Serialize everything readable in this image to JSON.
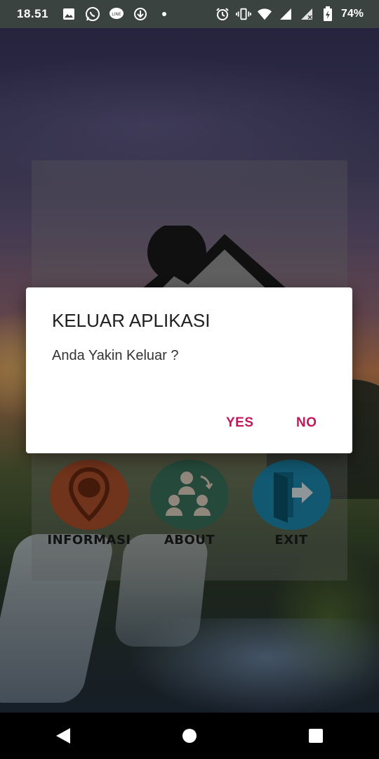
{
  "status_bar": {
    "time": "18.51",
    "battery_percent": "74%",
    "notification_icons": [
      "image-icon",
      "whatsapp-icon",
      "line-icon",
      "download-icon",
      "dot-icon"
    ],
    "system_icons": [
      "alarm-icon",
      "vibrate-icon",
      "wifi-icon",
      "signal-icon",
      "signal-noservice-icon",
      "battery-charging-icon"
    ]
  },
  "menu": {
    "items": [
      {
        "label": "INFORMASI",
        "color": "#b5532c",
        "icon": "location-pin-icon"
      },
      {
        "label": "ABOUT",
        "color": "#3d7862",
        "icon": "group-icon"
      },
      {
        "label": "EXIT",
        "color": "#1d8fb5",
        "icon": "exit-door-icon"
      }
    ]
  },
  "dialog": {
    "title": "KELUAR APLIKASI",
    "message": "Anda Yakin Keluar ?",
    "positive_label": "YES",
    "negative_label": "NO",
    "accent_color": "#c2185b"
  },
  "nav_bar": {
    "buttons": [
      "back-icon",
      "home-icon",
      "recents-icon"
    ]
  }
}
